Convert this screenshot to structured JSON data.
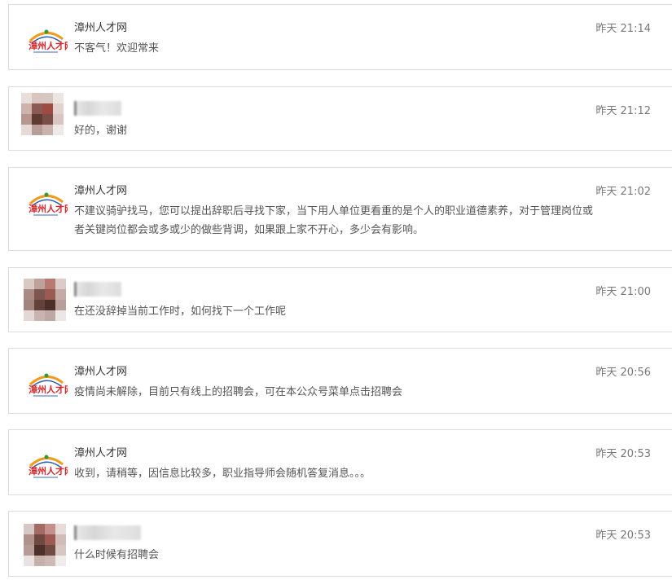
{
  "messages": [
    {
      "sender": "漳州人才网",
      "type": "org",
      "time": "昨天 21:14",
      "text": "不客气！欢迎常来"
    },
    {
      "sender": "",
      "type": "user",
      "time": "昨天 21:12",
      "text": "好的，谢谢"
    },
    {
      "sender": "漳州人才网",
      "type": "org",
      "time": "昨天 21:02",
      "text": "不建议骑驴找马，您可以提出辞职后寻找下家，当下用人单位更看重的是个人的职业道德素养，对于管理岗位或者关键岗位都会或多或少的做些背调，如果跟上家不开心，多少会有影响。"
    },
    {
      "sender": "",
      "type": "user",
      "time": "昨天 21:00",
      "text": "在还没辞掉当前工作时，如何找下一个工作呢"
    },
    {
      "sender": "漳州人才网",
      "type": "org",
      "time": "昨天 20:56",
      "text": "疫情尚未解除，目前只有线上的招聘会，可在本公众号菜单点击招聘会"
    },
    {
      "sender": "漳州人才网",
      "type": "org",
      "time": "昨天 20:53",
      "text": "收到，请稍等，因信息比较多，职业指导师会随机答复消息。。。"
    },
    {
      "sender": "",
      "type": "user",
      "time": "昨天 20:53",
      "text": "什么时候有招聘会"
    }
  ],
  "logo": {
    "icon": "zhangzhou-talent-logo",
    "colors": {
      "red": "#d8262b",
      "green": "#2f9a3c",
      "orange": "#f29a1c",
      "blue": "#2a5fb0"
    }
  },
  "avatar_icon": "blurred-user-avatar"
}
